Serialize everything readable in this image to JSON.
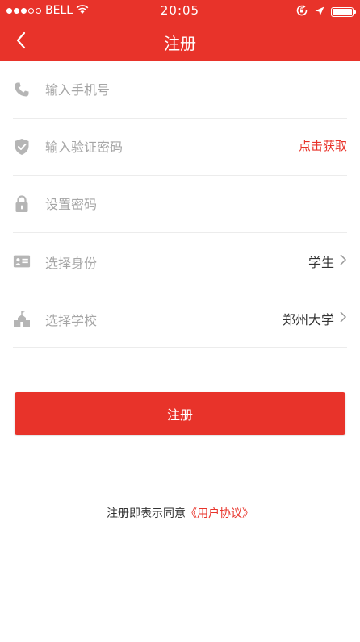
{
  "status_bar": {
    "carrier": "BELL",
    "time": "20:05"
  },
  "nav": {
    "back_icon": "chevron-left-icon",
    "title": "注册"
  },
  "form": {
    "phone": {
      "icon": "phone-icon",
      "placeholder": "输入手机号"
    },
    "code": {
      "icon": "shield-icon",
      "placeholder": "输入验证密码",
      "action": "点击获取"
    },
    "password": {
      "icon": "lock-icon",
      "placeholder": "设置密码"
    },
    "identity": {
      "icon": "id-card-icon",
      "label": "选择身份",
      "value": "学生"
    },
    "school": {
      "icon": "school-icon",
      "label": "选择学校",
      "value": "郑州大学"
    }
  },
  "submit_label": "注册",
  "agreement": {
    "text": "注册即表示同意",
    "link": "《用户协议》"
  },
  "colors": {
    "accent": "#e8332a",
    "icon": "#b5b5b5",
    "placeholder": "#a6a6a6",
    "divider": "#ececec"
  }
}
